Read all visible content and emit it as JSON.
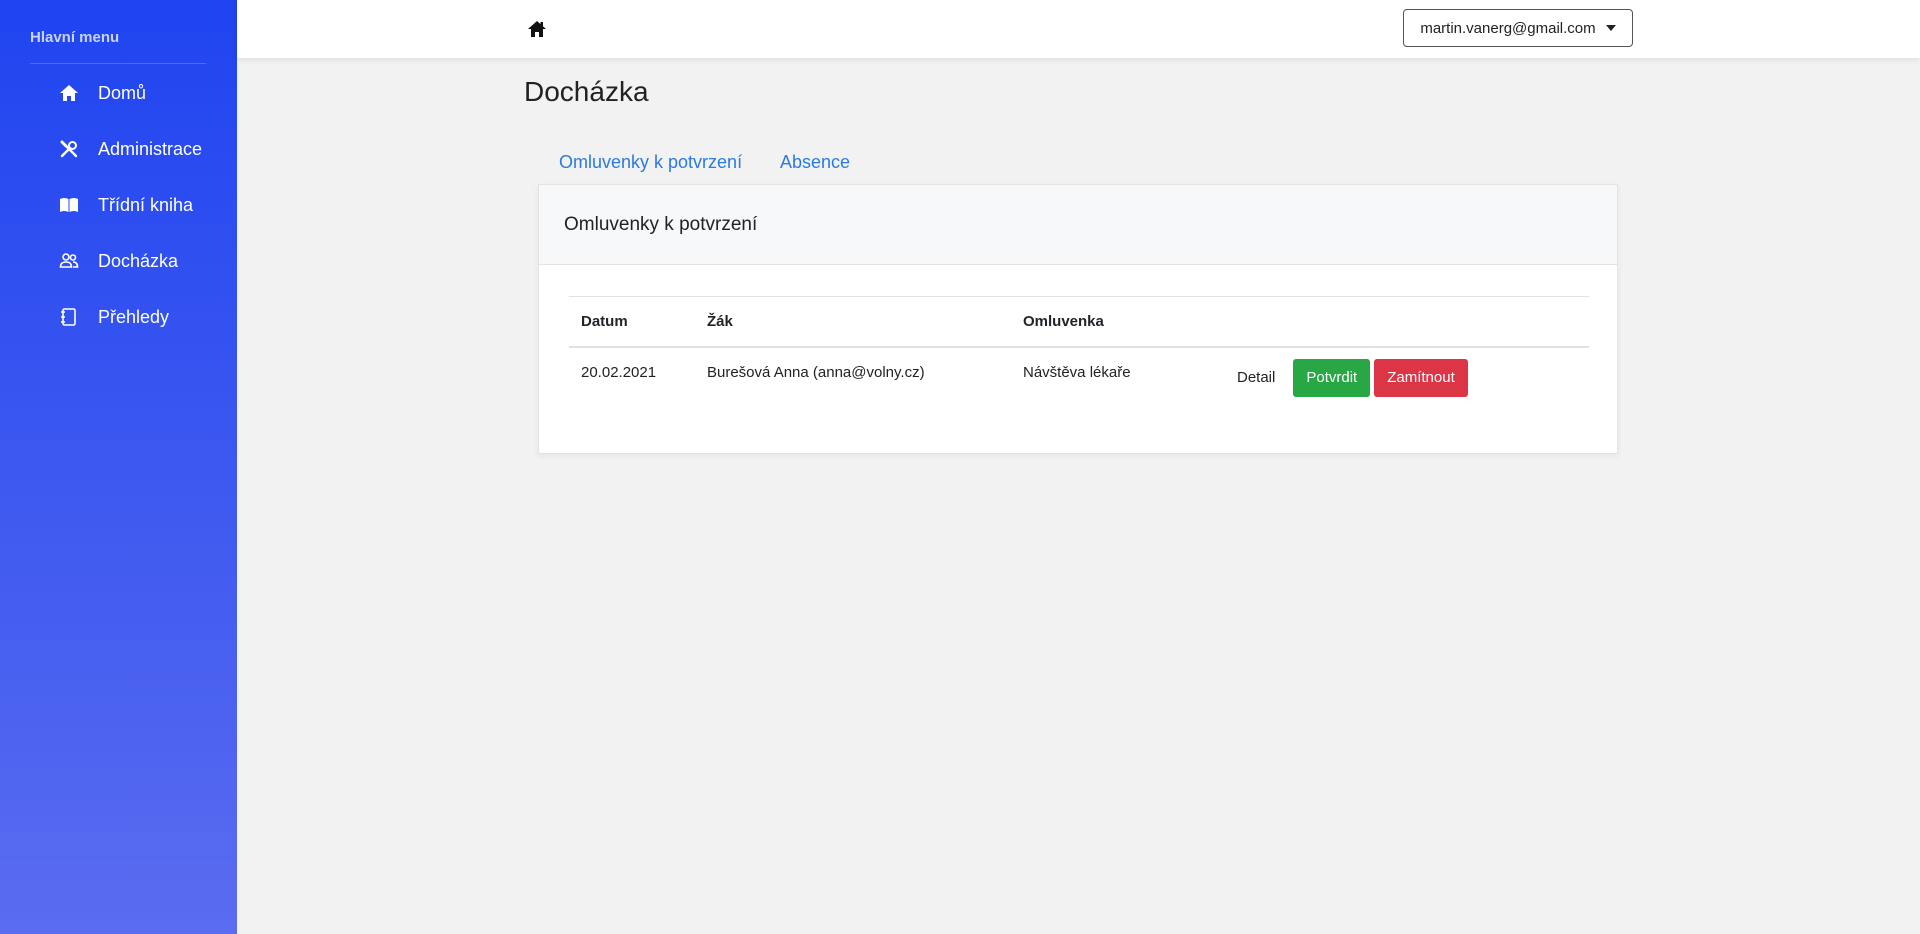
{
  "sidebar": {
    "heading": "Hlavní menu",
    "items": [
      {
        "label": "Domů",
        "icon": "home-icon"
      },
      {
        "label": "Administrace",
        "icon": "tools-icon"
      },
      {
        "label": "Třídní kniha",
        "icon": "book-icon"
      },
      {
        "label": "Docházka",
        "icon": "users-icon"
      },
      {
        "label": "Přehledy",
        "icon": "notebook-icon"
      }
    ]
  },
  "topbar": {
    "home_icon": "home-icon",
    "user_email": "martin.vanerg@gmail.com"
  },
  "page": {
    "title": "Docházka",
    "tabs": [
      {
        "label": "Omluvenky k potvrzení"
      },
      {
        "label": "Absence"
      }
    ]
  },
  "card": {
    "title": "Omluvenky k potvrzení",
    "columns": [
      "Datum",
      "Žák",
      "Omluvenka",
      ""
    ],
    "rows": [
      {
        "date": "20.02.2021",
        "student": "Burešová Anna (anna@volny.cz)",
        "excuse": "Návštěva lékaře",
        "detail_label": "Detail",
        "confirm_label": "Potvrdit",
        "reject_label": "Zamítnout"
      }
    ]
  },
  "colors": {
    "sidebar_top": "#1f44f0",
    "sidebar_bottom": "#5a6cf0",
    "link": "#2a7ae2",
    "success": "#28a745",
    "danger": "#dc3545"
  }
}
